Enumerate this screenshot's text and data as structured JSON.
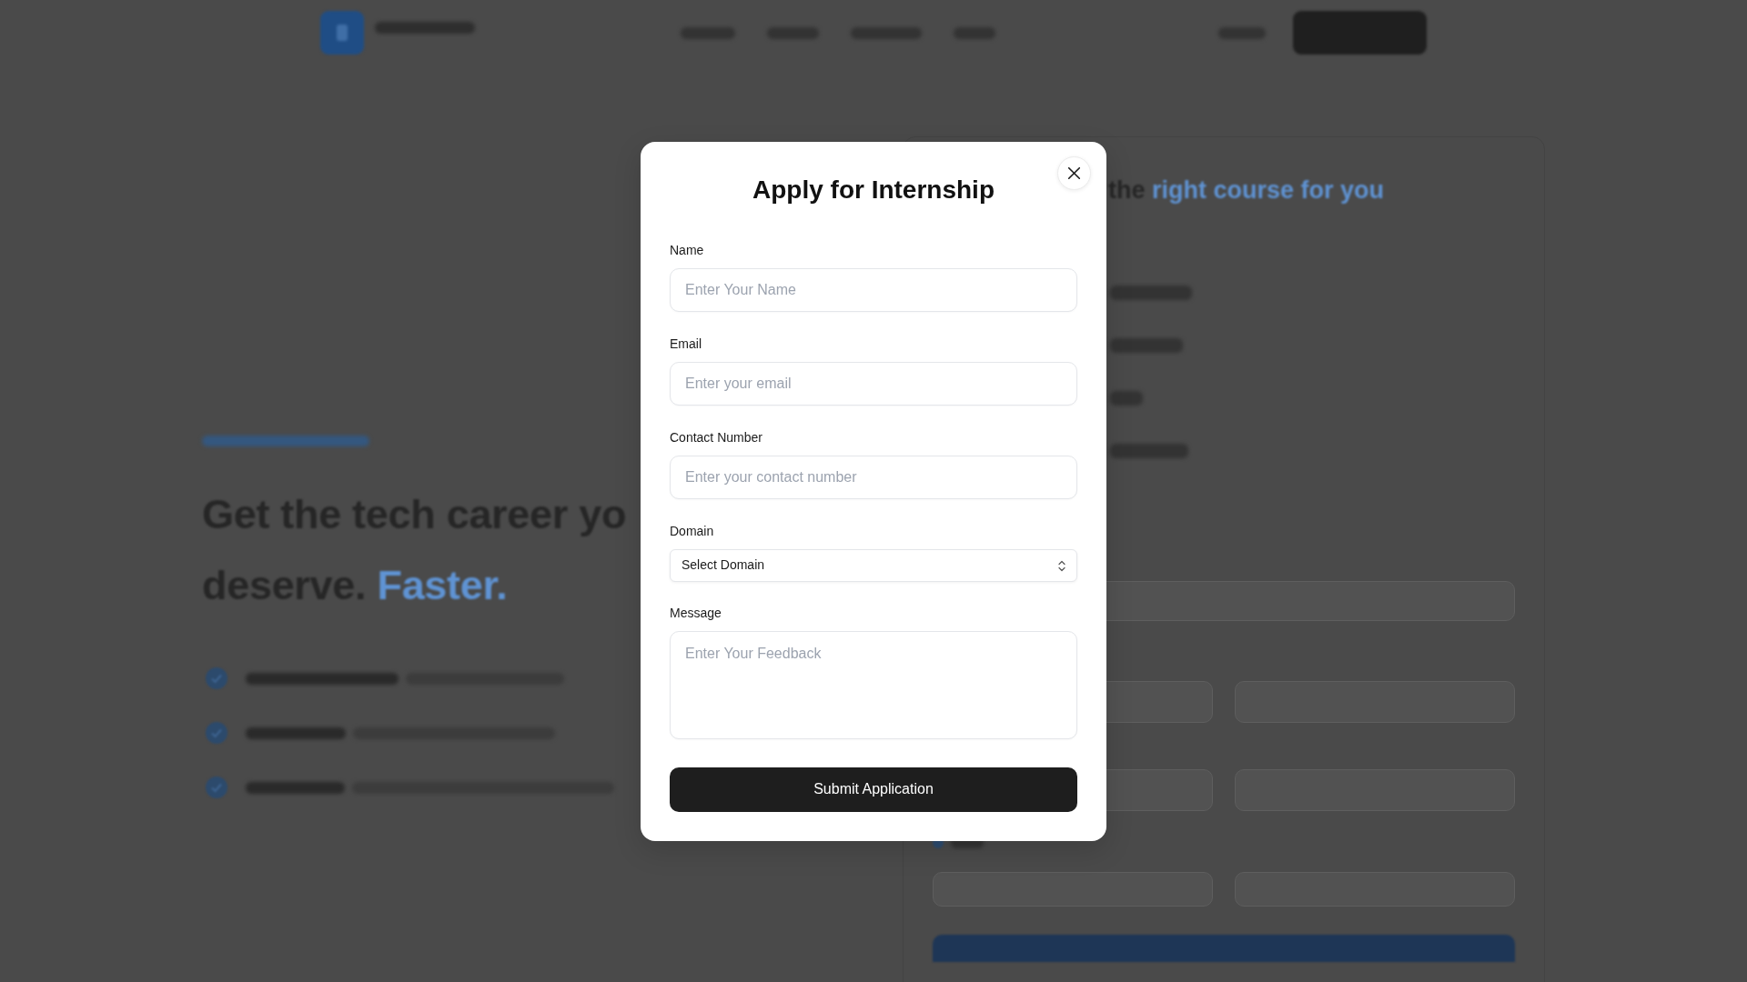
{
  "backdrop": {
    "hero": {
      "heading_line_1": "Get the tech career yo",
      "heading_line_2": "deserve.",
      "heading_accent": "Faster."
    },
    "course_panel": {
      "heading": "the",
      "heading_accent": "right course for you"
    }
  },
  "dialog": {
    "title": "Apply for Internship",
    "fields": [
      {
        "kind": "input",
        "label": "Name",
        "placeholder": "Enter Your Name"
      },
      {
        "kind": "input",
        "label": "Email",
        "placeholder": "Enter your email"
      },
      {
        "kind": "input",
        "label": "Contact Number",
        "placeholder": "Enter your contact number"
      },
      {
        "kind": "select",
        "label": "Domain",
        "value": "Select Domain"
      },
      {
        "kind": "textarea",
        "label": "Message",
        "placeholder": "Enter Your Feedback"
      }
    ],
    "submit_button": "Submit Application"
  }
}
